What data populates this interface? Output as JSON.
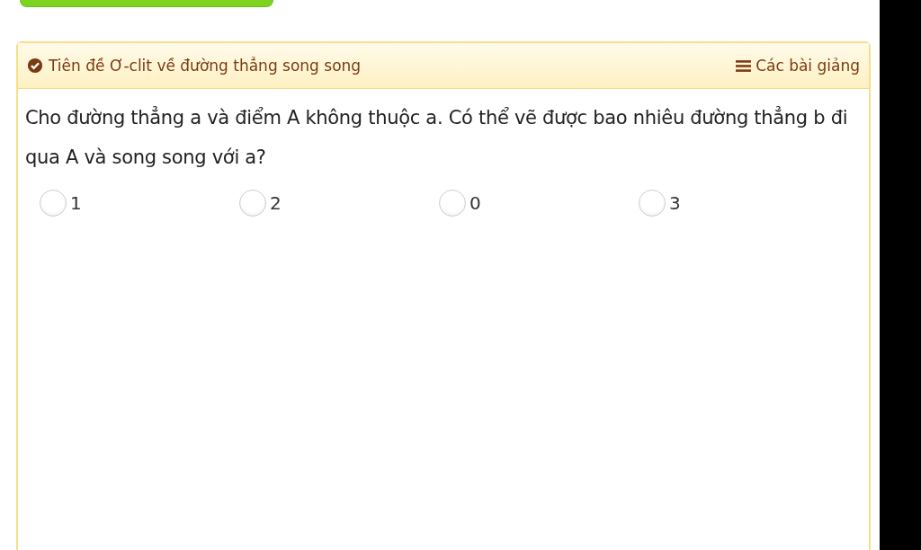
{
  "card": {
    "title": "Tiên đề Ơ-clit về đường thẳng song song",
    "lessons_link": "Các bài giảng",
    "question": "Cho đường thẳng a và điểm A không thuộc a. Có thể vẽ được bao nhiêu đường thẳng b đi qua A và song song với a?",
    "options": [
      {
        "label": "1",
        "selected": false
      },
      {
        "label": "2",
        "selected": false
      },
      {
        "label": "0",
        "selected": false
      },
      {
        "label": "3",
        "selected": false
      }
    ]
  }
}
